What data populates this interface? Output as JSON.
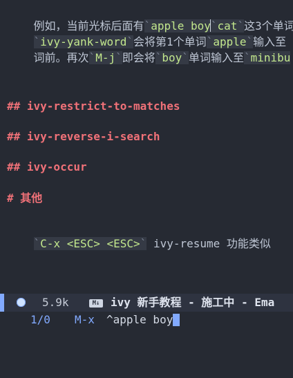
{
  "editor": {
    "para1": {
      "line1": {
        "t1": "例如，当前光标后面有",
        "tick": "`",
        "code1": "apple boy",
        "code2": "cat",
        "t2": "这3个单词"
      },
      "line2": {
        "tick": "`",
        "code1": "ivy-yank-word",
        "t1": "会将第1个单词",
        "code2": "apple",
        "t2": "输入至"
      },
      "line3": {
        "tick": "`",
        "t1": "词前。再次",
        "code1": "M-j",
        "t2": "即会将",
        "code2": "boy",
        "t3": "单词输入至",
        "code3": "minibu"
      }
    },
    "headings": [
      "## ivy-restrict-to-matches",
      "## ivy-reverse-i-search",
      "## ivy-occur",
      "# 其他"
    ],
    "last_line": {
      "tick": "`",
      "code": "C-x <ESC> <ESC>",
      "text": " ivy-resume 功能类似"
    }
  },
  "modeline": {
    "size": "5.9k",
    "md_icon": "M↓",
    "title": "ivy 新手教程 - 施工中 - Ema",
    "accent_color": "#82aaff"
  },
  "minibuffer": {
    "count": "1/0",
    "prompt": "M-x",
    "input": "^apple boy"
  }
}
